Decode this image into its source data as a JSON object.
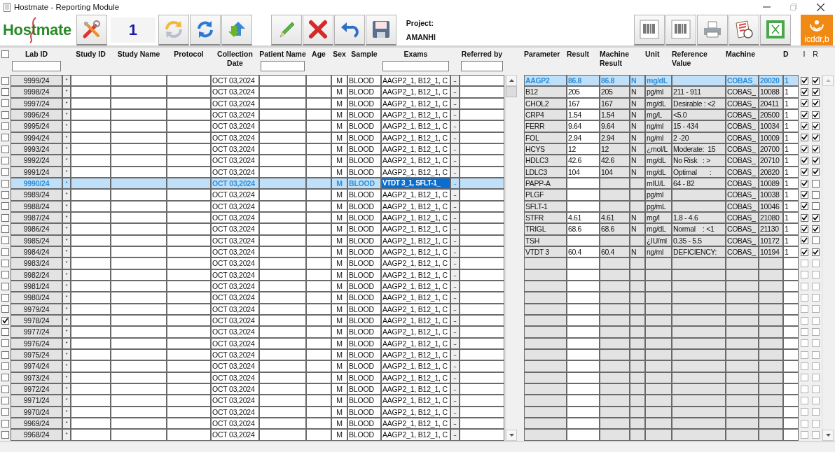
{
  "window": {
    "title": "Hostmate - Reporting Module"
  },
  "toolbar": {
    "logo": "Hostmate",
    "counter": "1",
    "project_label": "Project:",
    "project": "AMANHI",
    "org_badge": "icddr,b"
  },
  "samples": {
    "select_all": false,
    "columns": [
      {
        "label": "Lab ID",
        "filter": true
      },
      {
        "label": "Study ID",
        "filter": false
      },
      {
        "label": "Study Name",
        "filter": false
      },
      {
        "label": "Protocol",
        "filter": false
      },
      {
        "label": "Collection Date",
        "filter": false
      },
      {
        "label": "Patient Name",
        "filter": true
      },
      {
        "label": "Age",
        "filter": false
      },
      {
        "label": "Sex",
        "filter": false
      },
      {
        "label": "Sample",
        "filter": false
      },
      {
        "label": "Exams",
        "filter": true
      },
      {
        "label": "Referred by",
        "filter": true
      }
    ],
    "rows": [
      {
        "lab_id": "9999/24",
        "mark": "*",
        "date": "OCT 03,2024",
        "sex": "M",
        "sample": "BLOOD",
        "exams": "AAGP2_1, B12_1, C",
        "more": "..",
        "checked": false,
        "selected": false
      },
      {
        "lab_id": "9998/24",
        "mark": "*",
        "date": "OCT 03,2024",
        "sex": "M",
        "sample": "BLOOD",
        "exams": "AAGP2_1, B12_1, C",
        "more": "..",
        "checked": false,
        "selected": false
      },
      {
        "lab_id": "9997/24",
        "mark": "*",
        "date": "OCT 03,2024",
        "sex": "M",
        "sample": "BLOOD",
        "exams": "AAGP2_1, B12_1, C",
        "more": "..",
        "checked": false,
        "selected": false
      },
      {
        "lab_id": "9996/24",
        "mark": "*",
        "date": "OCT 03,2024",
        "sex": "M",
        "sample": "BLOOD",
        "exams": "AAGP2_1, B12_1, C",
        "more": "..",
        "checked": false,
        "selected": false
      },
      {
        "lab_id": "9995/24",
        "mark": "*",
        "date": "OCT 03,2024",
        "sex": "M",
        "sample": "BLOOD",
        "exams": "AAGP2_1, B12_1, C",
        "more": "..",
        "checked": false,
        "selected": false
      },
      {
        "lab_id": "9994/24",
        "mark": "*",
        "date": "OCT 03,2024",
        "sex": "M",
        "sample": "BLOOD",
        "exams": "AAGP2_1, B12_1, C",
        "more": "..",
        "checked": false,
        "selected": false
      },
      {
        "lab_id": "9993/24",
        "mark": "*",
        "date": "OCT 03,2024",
        "sex": "M",
        "sample": "BLOOD",
        "exams": "AAGP2_1, B12_1, C",
        "more": "..",
        "checked": false,
        "selected": false
      },
      {
        "lab_id": "9992/24",
        "mark": "*",
        "date": "OCT 03,2024",
        "sex": "M",
        "sample": "BLOOD",
        "exams": "AAGP2_1, B12_1, C",
        "more": "..",
        "checked": false,
        "selected": false
      },
      {
        "lab_id": "9991/24",
        "mark": "*",
        "date": "OCT 03,2024",
        "sex": "M",
        "sample": "BLOOD",
        "exams": "AAGP2_1, B12_1, C",
        "more": "..",
        "checked": false,
        "selected": false
      },
      {
        "lab_id": "9990/24",
        "mark": "*",
        "date": "OCT 03,2024",
        "sex": "M",
        "sample": "BLOOD",
        "exams": "VTDT 3_1, SFLT-1_",
        "more": "..",
        "checked": false,
        "selected": true
      },
      {
        "lab_id": "9989/24",
        "mark": "*",
        "date": "OCT 03,2024",
        "sex": "M",
        "sample": "BLOOD",
        "exams": "AAGP2_1, B12_1, C",
        "more": "..",
        "checked": false,
        "selected": false
      },
      {
        "lab_id": "9988/24",
        "mark": "*",
        "date": "OCT 03,2024",
        "sex": "M",
        "sample": "BLOOD",
        "exams": "AAGP2_1, B12_1, C",
        "more": "..",
        "checked": false,
        "selected": false
      },
      {
        "lab_id": "9987/24",
        "mark": "*",
        "date": "OCT 03,2024",
        "sex": "M",
        "sample": "BLOOD",
        "exams": "AAGP2_1, B12_1, C",
        "more": "..",
        "checked": false,
        "selected": false
      },
      {
        "lab_id": "9986/24",
        "mark": "*",
        "date": "OCT 03,2024",
        "sex": "M",
        "sample": "BLOOD",
        "exams": "AAGP2_1, B12_1, C",
        "more": "..",
        "checked": false,
        "selected": false
      },
      {
        "lab_id": "9985/24",
        "mark": "*",
        "date": "OCT 03,2024",
        "sex": "M",
        "sample": "BLOOD",
        "exams": "AAGP2_1, B12_1, C",
        "more": "..",
        "checked": false,
        "selected": false
      },
      {
        "lab_id": "9984/24",
        "mark": "*",
        "date": "OCT 03,2024",
        "sex": "M",
        "sample": "BLOOD",
        "exams": "AAGP2_1, B12_1, C",
        "more": "..",
        "checked": false,
        "selected": false
      },
      {
        "lab_id": "9983/24",
        "mark": "*",
        "date": "OCT 03,2024",
        "sex": "M",
        "sample": "BLOOD",
        "exams": "AAGP2_1, B12_1, C",
        "more": "..",
        "checked": false,
        "selected": false
      },
      {
        "lab_id": "9982/24",
        "mark": "*",
        "date": "OCT 03,2024",
        "sex": "M",
        "sample": "BLOOD",
        "exams": "AAGP2_1, B12_1, C",
        "more": "..",
        "checked": false,
        "selected": false
      },
      {
        "lab_id": "9981/24",
        "mark": "*",
        "date": "OCT 03,2024",
        "sex": "M",
        "sample": "BLOOD",
        "exams": "AAGP2_1, B12_1, C",
        "more": "..",
        "checked": false,
        "selected": false
      },
      {
        "lab_id": "9980/24",
        "mark": "*",
        "date": "OCT 03,2024",
        "sex": "M",
        "sample": "BLOOD",
        "exams": "AAGP2_1, B12_1, C",
        "more": "..",
        "checked": false,
        "selected": false
      },
      {
        "lab_id": "9979/24",
        "mark": "*",
        "date": "OCT 03,2024",
        "sex": "M",
        "sample": "BLOOD",
        "exams": "AAGP2_1, B12_1, C",
        "more": "..",
        "checked": false,
        "selected": false
      },
      {
        "lab_id": "9978/24",
        "mark": "*",
        "date": "OCT 03,2024",
        "sex": "M",
        "sample": "BLOOD",
        "exams": "AAGP2_1, B12_1, C",
        "more": "..",
        "checked": true,
        "selected": false
      },
      {
        "lab_id": "9977/24",
        "mark": "*",
        "date": "OCT 03,2024",
        "sex": "M",
        "sample": "BLOOD",
        "exams": "AAGP2_1, B12_1, C",
        "more": "..",
        "checked": false,
        "selected": false
      },
      {
        "lab_id": "9976/24",
        "mark": "*",
        "date": "OCT 03,2024",
        "sex": "M",
        "sample": "BLOOD",
        "exams": "AAGP2_1, B12_1, C",
        "more": "..",
        "checked": false,
        "selected": false
      },
      {
        "lab_id": "9975/24",
        "mark": "*",
        "date": "OCT 03,2024",
        "sex": "M",
        "sample": "BLOOD",
        "exams": "AAGP2_1, B12_1, C",
        "more": "..",
        "checked": false,
        "selected": false
      },
      {
        "lab_id": "9974/24",
        "mark": "*",
        "date": "OCT 03,2024",
        "sex": "M",
        "sample": "BLOOD",
        "exams": "AAGP2_1, B12_1, C",
        "more": "..",
        "checked": false,
        "selected": false
      },
      {
        "lab_id": "9973/24",
        "mark": "*",
        "date": "OCT 03,2024",
        "sex": "M",
        "sample": "BLOOD",
        "exams": "AAGP2_1, B12_1, C",
        "more": "..",
        "checked": false,
        "selected": false
      },
      {
        "lab_id": "9972/24",
        "mark": "*",
        "date": "OCT 03,2024",
        "sex": "M",
        "sample": "BLOOD",
        "exams": "AAGP2_1, B12_1, C",
        "more": "..",
        "checked": false,
        "selected": false
      },
      {
        "lab_id": "9971/24",
        "mark": "*",
        "date": "OCT 03,2024",
        "sex": "M",
        "sample": "BLOOD",
        "exams": "AAGP2_1, B12_1, C",
        "more": "..",
        "checked": false,
        "selected": false
      },
      {
        "lab_id": "9970/24",
        "mark": "*",
        "date": "OCT 03,2024",
        "sex": "M",
        "sample": "BLOOD",
        "exams": "AAGP2_1, B12_1, C",
        "more": "..",
        "checked": false,
        "selected": false
      },
      {
        "lab_id": "9969/24",
        "mark": "*",
        "date": "OCT 03,2024",
        "sex": "M",
        "sample": "BLOOD",
        "exams": "AAGP2_1, B12_1, C",
        "more": "..",
        "checked": false,
        "selected": false
      },
      {
        "lab_id": "9968/24",
        "mark": "*",
        "date": "OCT 03,2024",
        "sex": "M",
        "sample": "BLOOD",
        "exams": "AAGP2_1, B12_1, C",
        "more": "..",
        "checked": false,
        "selected": false
      }
    ]
  },
  "results": {
    "columns": [
      "Parameter",
      "Result",
      "Machine Result",
      "Unit",
      "Reference Value",
      "Machine",
      "D",
      "I",
      "R"
    ],
    "blank_rows": [
      {
        "i": false,
        "r": false
      },
      {
        "i": false,
        "r": false
      },
      {
        "i": false,
        "r": false
      },
      {
        "i": false,
        "r": false
      },
      {
        "i": false,
        "r": false
      },
      {
        "i": false,
        "r": false
      },
      {
        "i": false,
        "r": false
      },
      {
        "i": false,
        "r": false
      },
      {
        "i": false,
        "r": false
      },
      {
        "i": false,
        "r": false
      },
      {
        "i": false,
        "r": false
      },
      {
        "i": false,
        "r": false
      },
      {
        "i": false,
        "r": false
      },
      {
        "i": false,
        "r": false
      },
      {
        "i": false,
        "r": false
      },
      {
        "i": false,
        "r": false
      }
    ],
    "rows": [
      {
        "parameter": "AAGP2",
        "result": "86.8",
        "machine_result": "86.8",
        "flag": "N",
        "unit": "mg/dL",
        "machine": "COBAS_",
        "code": "20020",
        "d": "1",
        "i": true,
        "r": true,
        "selected": true
      },
      {
        "parameter": "B12",
        "result": "205",
        "machine_result": "205",
        "flag": "N",
        "unit": "pg/ml",
        "reference": "211 - 911",
        "machine": "COBAS_",
        "code": "10088",
        "d": "1",
        "i": true,
        "r": true,
        "selected": false
      },
      {
        "parameter": "CHOL2",
        "result": "167",
        "machine_result": "167",
        "flag": "N",
        "unit": "mg/dL",
        "reference": "Desirable : <2",
        "machine": "COBAS_",
        "code": "20411",
        "d": "1",
        "i": true,
        "r": true,
        "selected": false
      },
      {
        "parameter": "CRP4",
        "result": "1.54",
        "machine_result": "1.54",
        "flag": "N",
        "unit": "mg/L",
        "reference": "<5.0",
        "machine": "COBAS_",
        "code": "20500",
        "d": "1",
        "i": true,
        "r": true,
        "selected": false
      },
      {
        "parameter": "FERR",
        "result": "9.64",
        "machine_result": "9.64",
        "flag": "N",
        "unit": "ng/ml",
        "reference": "15 - 434",
        "machine": "COBAS_",
        "code": "10034",
        "d": "1",
        "i": true,
        "r": true,
        "selected": false
      },
      {
        "parameter": "FOL",
        "result": "2.94",
        "machine_result": "2.94",
        "flag": "N",
        "unit": "ng/ml",
        "reference": "2 -20",
        "machine": "COBAS_",
        "code": "10009",
        "d": "1",
        "i": true,
        "r": true,
        "selected": false
      },
      {
        "parameter": "HCYS",
        "result": "12",
        "machine_result": "12",
        "flag": "N",
        "unit": "¿mol/L",
        "reference": "Moderate:  15",
        "machine": "COBAS_",
        "code": "20700",
        "d": "1",
        "i": true,
        "r": true,
        "selected": false
      },
      {
        "parameter": "HDLC3",
        "result": "42.6",
        "machine_result": "42.6",
        "flag": "N",
        "unit": "mg/dL",
        "reference": "No Risk   : >",
        "machine": "COBAS_",
        "code": "20710",
        "d": "1",
        "i": true,
        "r": true,
        "selected": false
      },
      {
        "parameter": "LDLC3",
        "result": "104",
        "machine_result": "104",
        "flag": "N",
        "unit": "mg/dL",
        "reference": "Optimal       :",
        "machine": "COBAS_",
        "code": "20820",
        "d": "1",
        "i": true,
        "r": true,
        "selected": false
      },
      {
        "parameter": "PAPP-A",
        "unit": "mIU/L",
        "reference": "64 - 82",
        "machine": "COBAS_",
        "code": "10089",
        "d": "1",
        "i": true,
        "r": false,
        "selected": false
      },
      {
        "parameter": "PLGF",
        "unit": "pg/ml",
        "machine": "COBAS_",
        "code": "10038",
        "d": "1",
        "i": true,
        "r": false,
        "selected": false
      },
      {
        "parameter": "SFLT-1",
        "unit": "pg/mL",
        "machine": "COBAS_",
        "code": "10046",
        "d": "1",
        "i": true,
        "r": false,
        "selected": false
      },
      {
        "parameter": "STFR",
        "result": "4.61",
        "machine_result": "4.61",
        "flag": "N",
        "unit": "mg/l",
        "reference": "1.8 - 4.6",
        "machine": "COBAS_",
        "code": "21080",
        "d": "1",
        "i": true,
        "r": true,
        "selected": false
      },
      {
        "parameter": "TRIGL",
        "result": "68.6",
        "machine_result": "68.6",
        "flag": "N",
        "unit": "mg/dL",
        "reference": "Normal    : <1",
        "machine": "COBAS_",
        "code": "21130",
        "d": "1",
        "i": true,
        "r": true,
        "selected": false
      },
      {
        "parameter": "TSH",
        "unit": "¿IU/ml",
        "reference": "0.35 - 5.5",
        "machine": "COBAS_",
        "code": "10172",
        "d": "1",
        "i": true,
        "r": false,
        "selected": false
      },
      {
        "parameter": "VTDT 3",
        "result": "60.4",
        "machine_result": "60.4",
        "flag": "N",
        "unit": "ng/ml",
        "reference": "DEFICIENCY:",
        "machine": "COBAS_",
        "code": "10194",
        "d": "1",
        "i": true,
        "r": true,
        "selected": false
      }
    ]
  }
}
